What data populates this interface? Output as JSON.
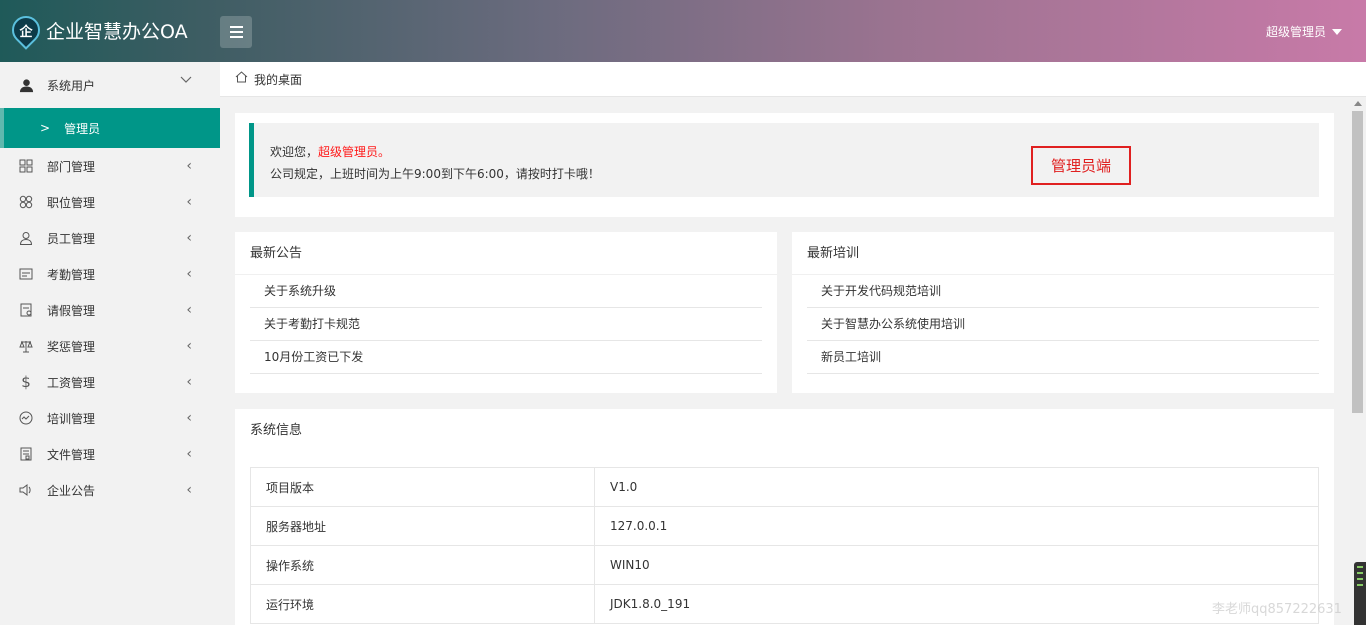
{
  "header": {
    "logo_glyph": "企",
    "app_title": "企业智慧办公OA",
    "user_name": "超级管理员"
  },
  "sidebar": {
    "items": [
      {
        "label": "系统用户",
        "icon": "user-icon",
        "expanded": true,
        "children": [
          {
            "label": "管理员"
          }
        ]
      },
      {
        "label": "部门管理",
        "icon": "grid-icon"
      },
      {
        "label": "职位管理",
        "icon": "clover-icon"
      },
      {
        "label": "员工管理",
        "icon": "person-outline-icon"
      },
      {
        "label": "考勤管理",
        "icon": "calendar-icon"
      },
      {
        "label": "请假管理",
        "icon": "leave-form-icon"
      },
      {
        "label": "奖惩管理",
        "icon": "scale-icon"
      },
      {
        "label": "工资管理",
        "icon": "dollar-icon"
      },
      {
        "label": "培训管理",
        "icon": "chart-icon"
      },
      {
        "label": "文件管理",
        "icon": "file-icon"
      },
      {
        "label": "企业公告",
        "icon": "speaker-icon"
      }
    ]
  },
  "breadcrumb": {
    "label": "我的桌面"
  },
  "welcome": {
    "greeting": "欢迎您，",
    "user": "超级管理员。",
    "rule": "公司规定，上班时间为上午9:00到下午6:00，请按时打卡哦！",
    "badge": "管理员端"
  },
  "notices": {
    "title": "最新公告",
    "items": [
      "关于系统升级",
      "关于考勤打卡规范",
      "10月份工资已下发"
    ]
  },
  "training": {
    "title": "最新培训",
    "items": [
      "关于开发代码规范培训",
      "关于智慧办公系统使用培训",
      "新员工培训"
    ]
  },
  "sysinfo": {
    "title": "系统信息",
    "rows": [
      {
        "key": "项目版本",
        "value": "V1.0"
      },
      {
        "key": "服务器地址",
        "value": "127.0.0.1"
      },
      {
        "key": "操作系统",
        "value": "WIN10"
      },
      {
        "key": "运行环境",
        "value": "JDK1.8.0_191"
      }
    ]
  },
  "watermark": "李老师qq857222631"
}
